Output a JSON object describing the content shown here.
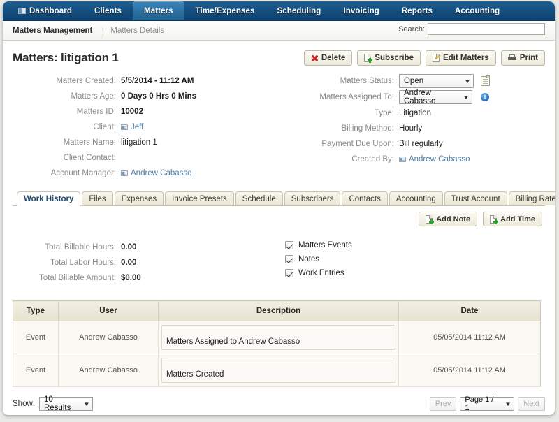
{
  "topnav": {
    "items": [
      {
        "label": "Dashboard",
        "icon": "dashboard-icon",
        "active": false
      },
      {
        "label": "Clients",
        "active": false
      },
      {
        "label": "Matters",
        "active": true
      },
      {
        "label": "Time/Expenses",
        "active": false
      },
      {
        "label": "Scheduling",
        "active": false
      },
      {
        "label": "Invoicing",
        "active": false
      },
      {
        "label": "Reports",
        "active": false
      },
      {
        "label": "Accounting",
        "active": false
      }
    ]
  },
  "breadcrumb": {
    "root": "Matters Management",
    "current": "Matters Details"
  },
  "search": {
    "label": "Search:",
    "value": "",
    "placeholder": ""
  },
  "header": {
    "title": "Matters: litigation 1",
    "actions": [
      {
        "label": "Delete",
        "icon": "delete-x-icon"
      },
      {
        "label": "Subscribe",
        "icon": "document-add-icon"
      },
      {
        "label": "Edit Matters",
        "icon": "document-edit-icon"
      },
      {
        "label": "Print",
        "icon": "printer-icon"
      }
    ]
  },
  "details": {
    "left": [
      {
        "label": "Matters Created:",
        "value": "5/5/2014 - 11:12 AM",
        "type": "text"
      },
      {
        "label": "Matters Age:",
        "value": "0 Days 0 Hrs 0 Mins",
        "type": "text"
      },
      {
        "label": "Matters ID:",
        "value": "10002",
        "type": "text"
      },
      {
        "label": "Client:",
        "value": "Jeff",
        "type": "link"
      },
      {
        "label": "Matters Name:",
        "value": "litigation 1",
        "type": "text"
      },
      {
        "label": "Client Contact:",
        "value": "",
        "type": "text"
      },
      {
        "label": "Account Manager:",
        "value": "Andrew Cabasso",
        "type": "link"
      }
    ],
    "right": {
      "status": {
        "label": "Matters Status:",
        "value": "Open",
        "icon": "note-icon"
      },
      "assigned": {
        "label": "Matters Assigned To:",
        "value": "Andrew Cabasso",
        "icon": "info-icon"
      },
      "rows": [
        {
          "label": "Type:",
          "value": "Litigation",
          "type": "text"
        },
        {
          "label": "Billing Method:",
          "value": "Hourly",
          "type": "text"
        },
        {
          "label": "Payment Due Upon:",
          "value": "Bill regularly",
          "type": "text"
        },
        {
          "label": "Created By:",
          "value": "Andrew Cabasso",
          "type": "link"
        }
      ]
    }
  },
  "tabs": [
    {
      "label": "Work History",
      "active": true
    },
    {
      "label": "Files",
      "active": false
    },
    {
      "label": "Expenses",
      "active": false
    },
    {
      "label": "Invoice Presets",
      "active": false
    },
    {
      "label": "Schedule",
      "active": false
    },
    {
      "label": "Subscribers",
      "active": false
    },
    {
      "label": "Contacts",
      "active": false
    },
    {
      "label": "Accounting",
      "active": false
    },
    {
      "label": "Trust Account",
      "active": false
    },
    {
      "label": "Billing Rates",
      "active": false
    }
  ],
  "pane": {
    "buttons": [
      {
        "label": "Add Note",
        "icon": "note-add-icon"
      },
      {
        "label": "Add Time",
        "icon": "note-add-icon"
      }
    ],
    "totals": [
      {
        "label": "Total Billable Hours:",
        "value": "0.00"
      },
      {
        "label": "Total Labor Hours:",
        "value": "0.00"
      },
      {
        "label": "Total Billable Amount:",
        "value": "$0.00"
      }
    ],
    "filters": [
      {
        "label": "Matters Events",
        "checked": true
      },
      {
        "label": "Notes",
        "checked": true
      },
      {
        "label": "Work Entries",
        "checked": true
      }
    ]
  },
  "table": {
    "columns": [
      "Type",
      "User",
      "Description",
      "Date"
    ],
    "rows": [
      {
        "type": "Event",
        "user": "Andrew Cabasso",
        "description": "Matters Assigned to Andrew Cabasso",
        "date": "05/05/2014 11:12 AM"
      },
      {
        "type": "Event",
        "user": "Andrew Cabasso",
        "description": "Matters Created",
        "date": "05/05/2014 11:12 AM"
      }
    ]
  },
  "footer": {
    "show_label": "Show:",
    "show_value": "10 Results",
    "prev_label": "Prev",
    "page_value": "Page 1 / 1",
    "next_label": "Next"
  },
  "colors": {
    "nav": "#155080",
    "nav_active": "#2a6e9f",
    "link": "#4c7ea8",
    "delete": "#cc2222",
    "button_face": "#eeebdd"
  }
}
